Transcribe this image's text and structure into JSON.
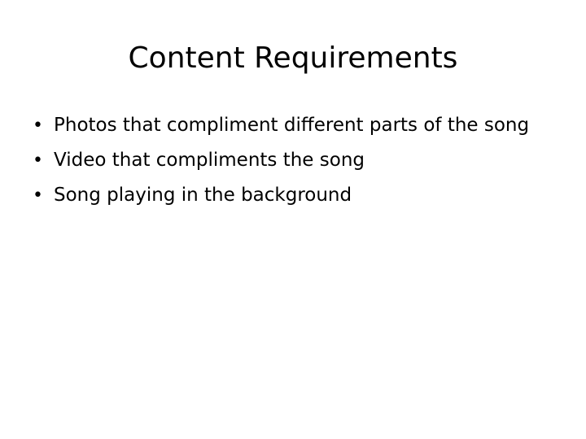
{
  "slide": {
    "title": "Content Requirements",
    "bullet_marker": "•",
    "bullets": [
      {
        "text": "Photos that compliment different parts of the song"
      },
      {
        "text": "Video that compliments the song"
      },
      {
        "text": "Song playing in the background"
      }
    ]
  }
}
